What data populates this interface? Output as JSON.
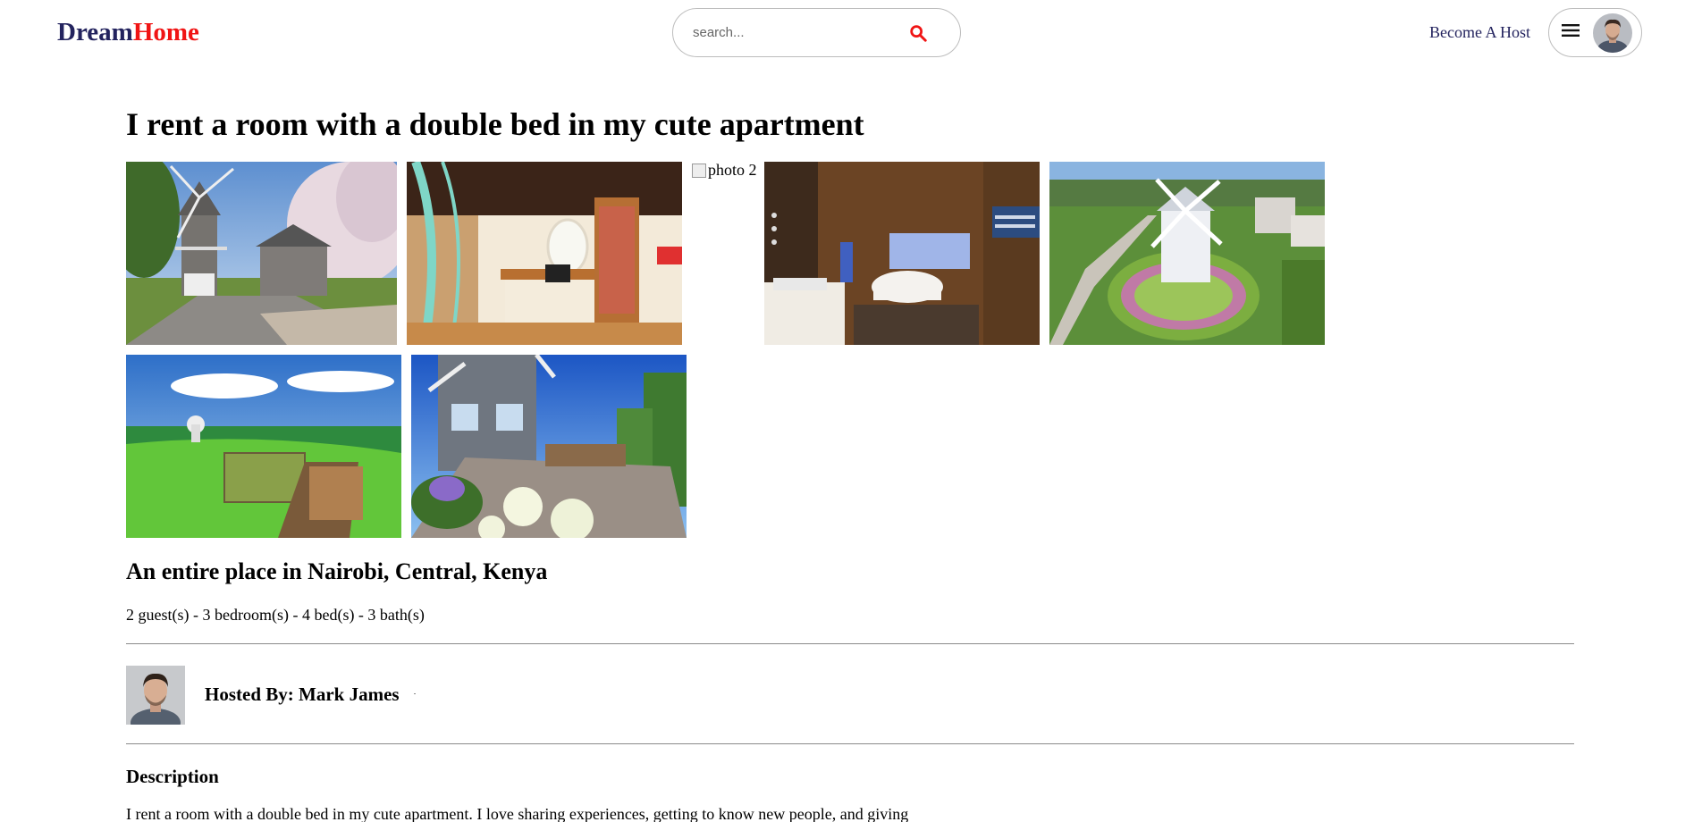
{
  "header": {
    "logo_part1": "Dream",
    "logo_part2": "Home",
    "search_placeholder": "search...",
    "become_host": "Become A Host",
    "icons": {
      "search": "search-icon",
      "menu": "hamburger-menu-icon",
      "user": "user-avatar"
    },
    "accent_color": "#f01414",
    "brand_color": "#23235e"
  },
  "listing": {
    "title": "I rent a room with a double bed in my cute apartment",
    "broken_photo_alt": "photo 2",
    "place": "An entire place in Nairobi, Central, Kenya",
    "stats": "2 guest(s) - 3 bedroom(s) - 4 bed(s) - 3 bath(s)",
    "host": "Hosted By: Mark James",
    "description_heading": "Description",
    "description": "I rent a room with a double bed in my cute apartment. I love sharing experiences, getting to know new people, and giving"
  }
}
